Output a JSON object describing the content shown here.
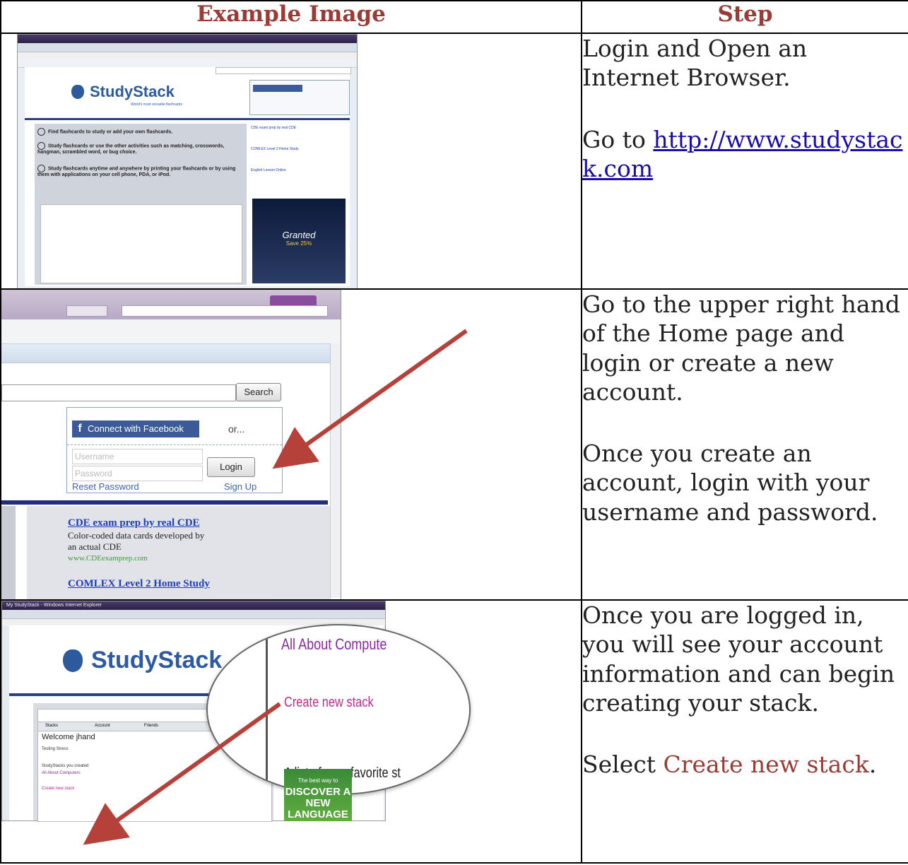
{
  "table": {
    "header_image": "Example Image",
    "header_step": "Step"
  },
  "rows": [
    {
      "p1": "Login and Open an Internet Browser.",
      "p2_prefix": "Go to ",
      "p2_link": "http://www.studystack.com"
    },
    {
      "p1": "Go to the upper right hand of the Home page and login or create a new account.",
      "p2": "Once you create an account, login with your username and password."
    },
    {
      "p1": "Once you are logged in, you will see your account information and can begin creating your stack.",
      "p2_prefix": "Select ",
      "p2_accent": "Create new stack",
      "p2_suffix": "."
    }
  ],
  "shot1": {
    "logo": "StudyStack",
    "tagline": "World's most versatile flashcards",
    "steps": [
      "Find flashcards to study or add your own flashcards.",
      "Study flashcards or use the other activities such as matching, crosswords, hangman, scrambled word, or bug choice.",
      "Study flashcards anytime and anywhere by printing your flashcards or by using them with applications on your cell phone, PDA, or iPod."
    ],
    "ad_title": "CDE exam prep by real CDE",
    "ad2_title": "COMLEX Level 2 Home Study",
    "ad3_title": "English Lesson Online",
    "banner_word": "Granted",
    "banner_text": "Save 25%"
  },
  "shot2": {
    "search_button": "Search",
    "facebook_button": "Connect with Facebook",
    "or_text": "or...",
    "username_placeholder": "Username",
    "password_placeholder": "Password",
    "login_button": "Login",
    "reset_link": "Reset Password",
    "signup_link": "Sign Up",
    "ad_title": "CDE exam prep by real CDE",
    "ad_desc1": "Color-coded data cards developed by",
    "ad_desc2": "an actual CDE",
    "ad_url": "www.CDEexamprep.com",
    "ad2_title": "COMLEX Level 2 Home Study"
  },
  "shot3": {
    "window_title": "My StudyStack - Windows Internet Explorer",
    "logo": "StudyStack",
    "welcome": "Welcome jhand",
    "tab_stacks": "Stacks",
    "tab_account": "Account",
    "tab_friends": "Friends",
    "testing": "Testing Stress",
    "stacks_created": "StudyStacks you created",
    "stack_name": "All About Computers",
    "create_link_small": "Create new stack",
    "mag_top": "All About Compute",
    "mag_create": "Create new stack",
    "mag_bottom": "A list of your favorite st",
    "green_small": "The best way to",
    "green_big": "DISCOVER A NEW LANGUAGE"
  }
}
